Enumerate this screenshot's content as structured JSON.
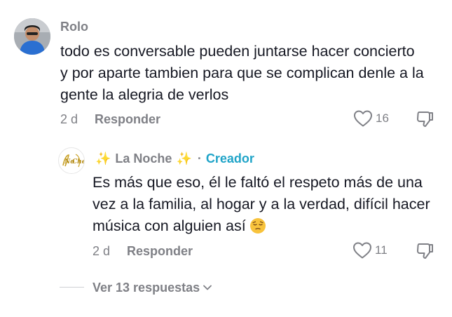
{
  "comment": {
    "username": "Rolo",
    "text": "todo es conversable pueden juntarse hacer concierto y por aparte tambien para que se complican denle a la gente la alegria de verlos",
    "date": "2 d",
    "reply_label": "Responder",
    "like_count": "16",
    "icons": {
      "like": "heart-outline-icon",
      "dislike": "thumbs-down-icon",
      "avatar": "user-avatar"
    }
  },
  "reply": {
    "username": "La Noche",
    "sparkle_left": "✨",
    "sparkle_right": "✨",
    "separator": "·",
    "creator_badge": "Creador",
    "avatar_logo": "NoChe",
    "text": "Es más que eso, él le faltó el respeto más de una vez a la familia, al hogar y a la verdad, difícil hacer música con alguien así",
    "date": "2 d",
    "reply_label": "Responder",
    "like_count": "11",
    "emoji": "pensive-face-emoji"
  },
  "view_replies": {
    "label": "Ver 13 respuestas",
    "icon": "chevron-down-icon"
  },
  "colors": {
    "text": "#161823",
    "muted": "#7f8086",
    "creator": "#20a4c8",
    "sparkle": "#f7c531"
  }
}
